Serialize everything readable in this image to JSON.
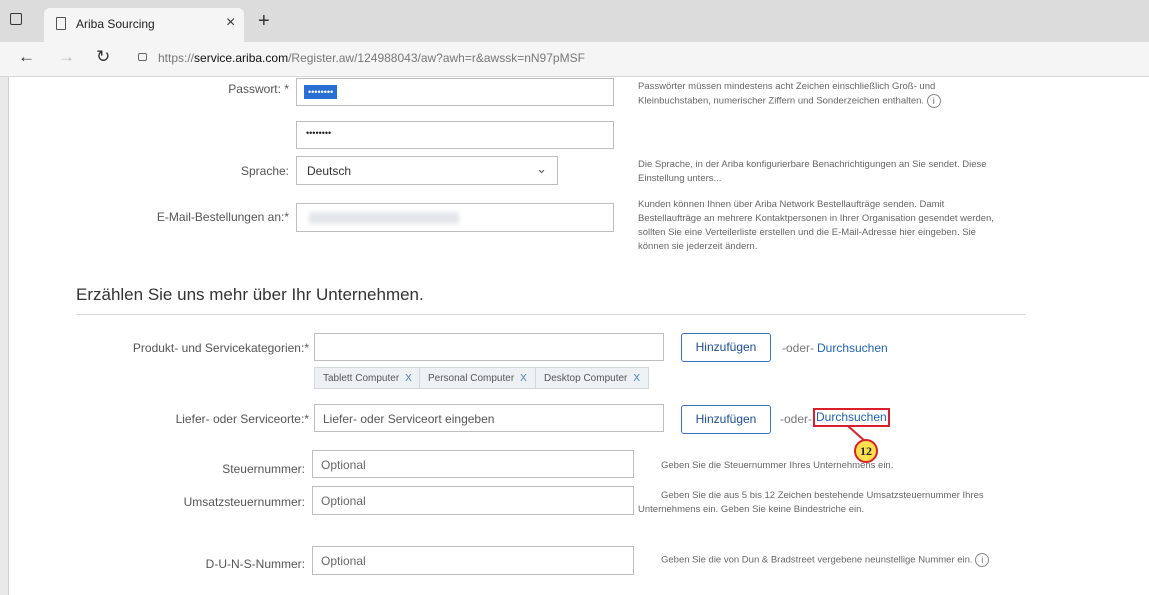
{
  "browser": {
    "tab_title": "Ariba Sourcing",
    "tab_close": "×",
    "new_tab": "+",
    "url_prefix": "https://",
    "url_domain": "service.ariba.com",
    "url_path": "/Register.aw/124988043/aw?awh=r&awssk=nN97pMSF"
  },
  "form": {
    "password": {
      "label": "Passwort:",
      "required": "*",
      "value": "••••••••",
      "confirm_value": "••••••••",
      "help": "Passwörter müssen mindestens acht Zeichen einschließlich Groß- und Kleinbuchstaben, numerischer Ziffern und Sonderzeichen enthalten."
    },
    "language": {
      "label": "Sprache:",
      "value": "Deutsch",
      "help": "Die Sprache, in der Ariba konfigurierbare Benachrichtigungen an Sie sendet. Diese Einstellung unters..."
    },
    "email_orders": {
      "label": "E-Mail-Bestellungen an:",
      "required": "*",
      "help": "Kunden können Ihnen über Ariba Network Bestellaufträge senden. Damit Bestellaufträge an mehrere Kontaktpersonen in Ihrer Organisation gesendet werden, sollten Sie eine Verteilerliste erstellen und die E-Mail-Adresse hier eingeben. Sie können sie jederzeit ändern."
    },
    "section_title": "Erzählen Sie uns mehr über Ihr Unternehmen.",
    "categories": {
      "label": "Produkt- und Servicekategorien:",
      "required": "*",
      "add_button": "Hinzufügen",
      "or": "-oder-",
      "browse": "Durchsuchen",
      "chips": [
        "Tablett Computer",
        "Personal Computer",
        "Desktop Computer"
      ],
      "chip_remove": "X"
    },
    "locations": {
      "label": "Liefer- oder Serviceorte:",
      "required": "*",
      "placeholder": "Liefer- oder Serviceort eingeben",
      "add_button": "Hinzufügen",
      "or": "-oder-",
      "browse": "Durchsuchen",
      "callout": "12"
    },
    "tax_number": {
      "label": "Steuernummer:",
      "placeholder": "Optional",
      "help": "Geben Sie die Steuernummer Ihres Unternehmens ein."
    },
    "vat_number": {
      "label": "Umsatzsteuernummer:",
      "placeholder": "Optional",
      "help": "Geben Sie die aus 5 bis 12 Zeichen bestehende Umsatzsteuernummer Ihres Unternehmens ein. Geben Sie keine Bindestriche ein."
    },
    "duns": {
      "label": "D-U-N-S-Nummer:",
      "placeholder": "Optional",
      "help": "Geben Sie die von Dun & Bradstreet vergebene neunstellige Nummer ein."
    }
  },
  "icons": {
    "info": "i",
    "callout_color": "#d9202a",
    "callout_fill": "#ffe14d"
  }
}
